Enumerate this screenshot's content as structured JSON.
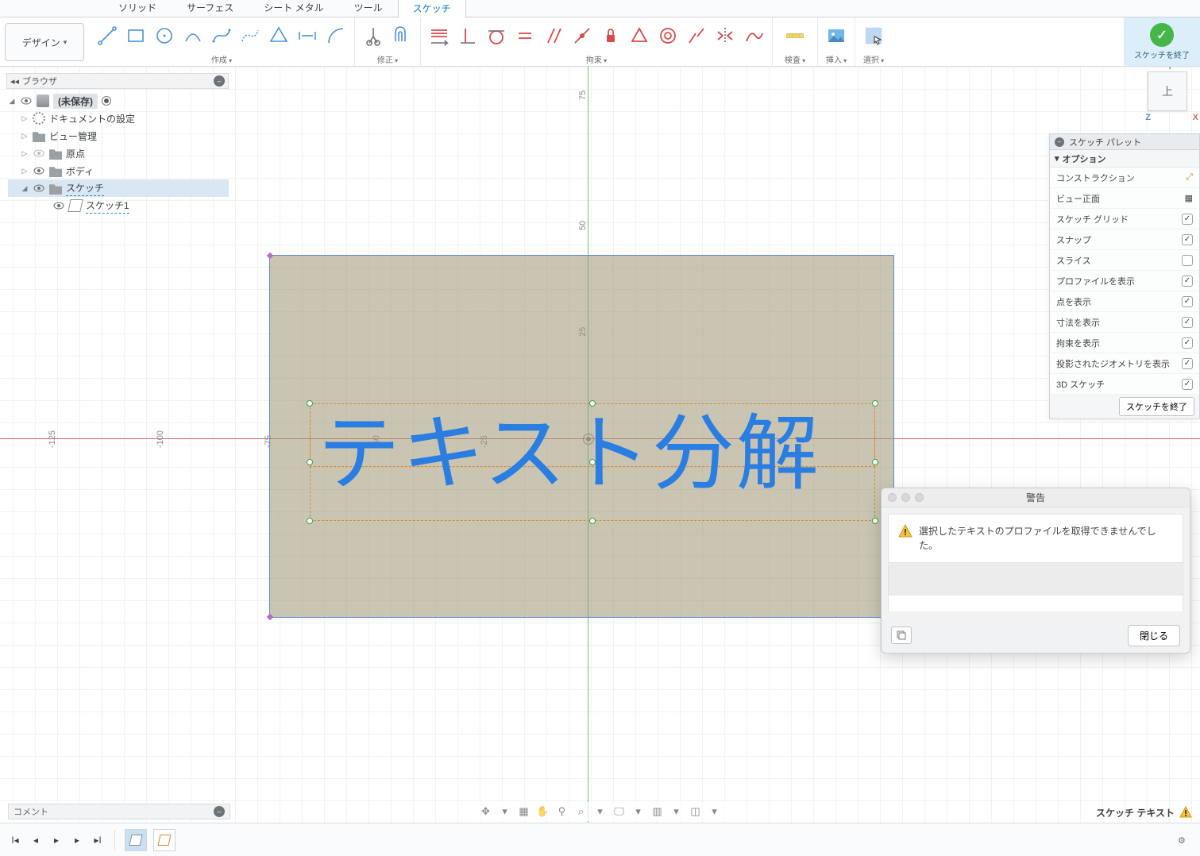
{
  "tabs": {
    "solid": "ソリッド",
    "surface": "サーフェス",
    "sheetmetal": "シート メタル",
    "tools": "ツール",
    "sketch": "スケッチ"
  },
  "design_btn": "デザイン",
  "toolgroups": {
    "create": "作成",
    "modify": "修正",
    "constrain": "拘束",
    "inspect": "検査",
    "insert": "挿入",
    "select": "選択"
  },
  "finish_label": "スケッチを終了",
  "browser_title": "ブラウザ",
  "browser": {
    "root": "(未保存)",
    "doc_settings": "ドキュメントの設定",
    "views": "ビュー管理",
    "origin": "原点",
    "bodies": "ボディ",
    "sketches": "スケッチ",
    "sketch1": "スケッチ1"
  },
  "grid_ticks": {
    "x": [
      "-125",
      "-100",
      "-75",
      "-50",
      "-25"
    ],
    "y": [
      "25",
      "50",
      "75"
    ]
  },
  "viewcube": "上",
  "sketch_text": "テキスト分解",
  "palette": {
    "title": "スケッチ パレット",
    "options": "オプション",
    "items": {
      "construction": "コンストラクション",
      "look_at": "ビュー正面",
      "grid": "スケッチ グリッド",
      "snap": "スナップ",
      "slice": "スライス",
      "profiles": "プロファイルを表示",
      "points": "点を表示",
      "dims": "寸法を表示",
      "constraints": "拘束を表示",
      "projected": "投影されたジオメトリを表示",
      "sketch3d": "3D スケッチ"
    },
    "finish": "スケッチを終了"
  },
  "dialog": {
    "title": "警告",
    "message": "選択したテキストのプロファイルを取得できませんでした。",
    "close": "閉じる"
  },
  "comment_label": "コメント",
  "status_text": "スケッチ テキスト"
}
